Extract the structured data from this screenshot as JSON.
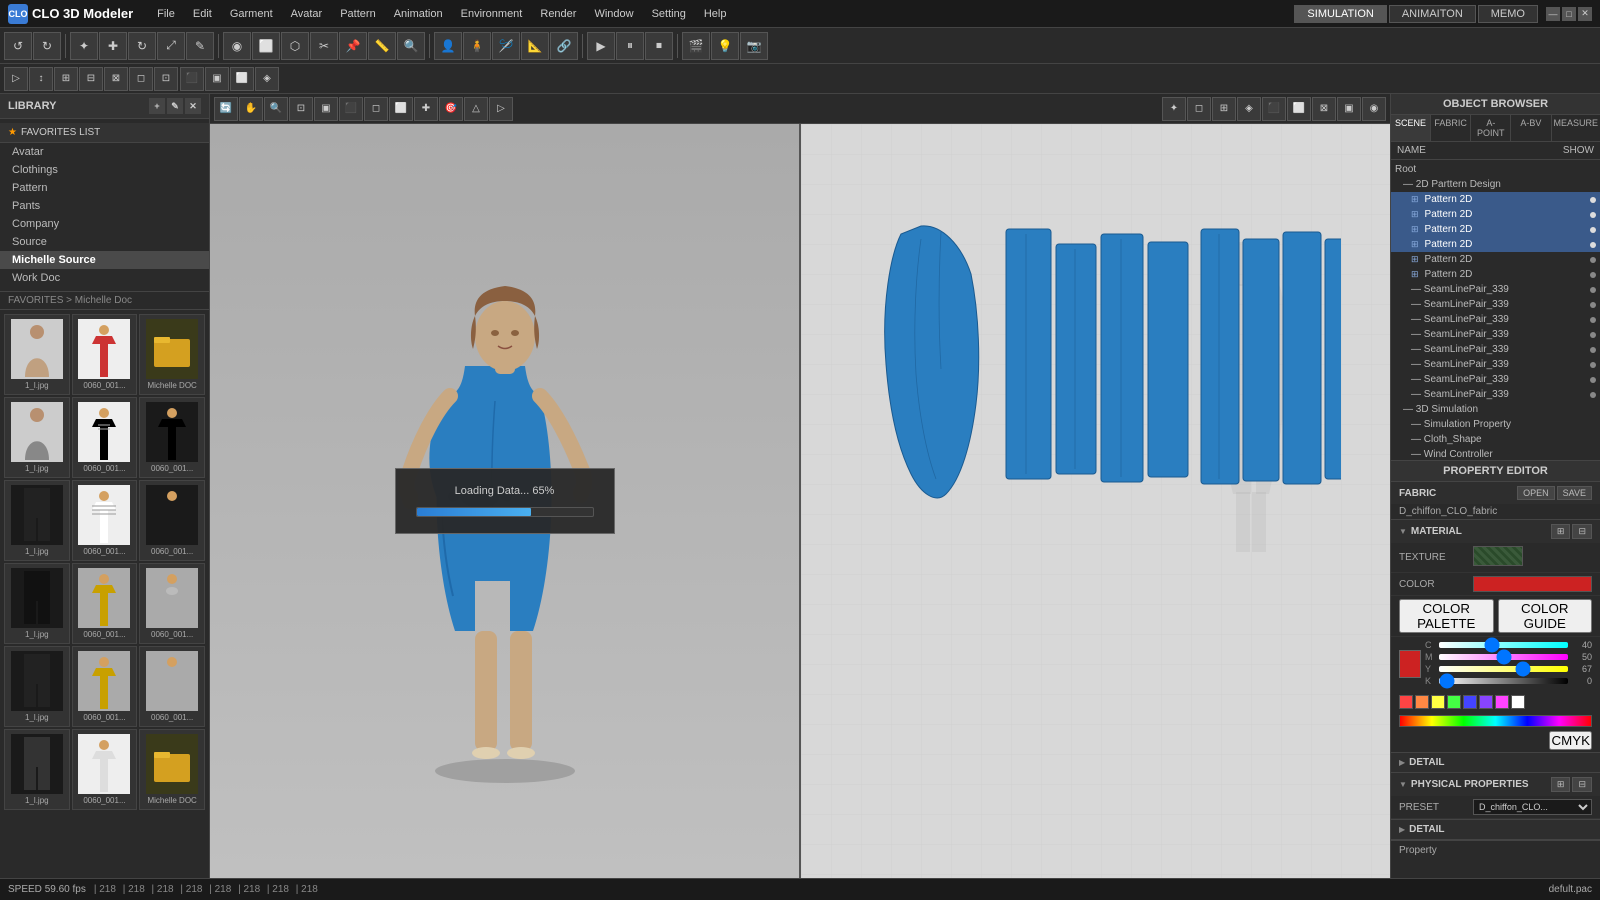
{
  "app": {
    "title": "CLO 3D Modeler",
    "logo_text": "CLO"
  },
  "topbar": {
    "menu_items": [
      "File",
      "Edit",
      "Garment",
      "Avatar",
      "Pattern",
      "Animation",
      "Environment",
      "Render",
      "Window",
      "Setting",
      "Help"
    ],
    "right_tabs": [
      "SIMULATION",
      "ANIMAITON",
      "MEMO"
    ],
    "win_btns": [
      "—",
      "□",
      "✕"
    ]
  },
  "library": {
    "header": "LIBRARY",
    "nav_items": [
      "Avatar",
      "Clothings",
      "Pattern",
      "Pants",
      "Company",
      "Source",
      "Michelle Source",
      "Work Doc"
    ],
    "active_nav": "Michelle Source",
    "favorites_label": "FAVORITES LIST",
    "breadcrumb": "FAVORITES > Michelle Doc",
    "grid_items": [
      {
        "label": "1_l.jpg",
        "type": "avatar"
      },
      {
        "label": "0060_001...",
        "type": "shirt"
      },
      {
        "label": "Michelle DOC",
        "type": "folder"
      },
      {
        "label": "1_l.jpg",
        "type": "avatar2"
      },
      {
        "label": "0060_001...",
        "type": "shirt2"
      },
      {
        "label": "0060_001...",
        "type": "jacket"
      },
      {
        "label": "1_l.jpg",
        "type": "pants"
      },
      {
        "label": "0060_001...",
        "type": "striped"
      },
      {
        "label": "0060_001...",
        "type": "jacket2"
      },
      {
        "label": "1_l.jpg",
        "type": "pants2"
      },
      {
        "label": "0060_001...",
        "type": "yellow"
      },
      {
        "label": "0060_001...",
        "type": "armor"
      },
      {
        "label": "1_l.jpg",
        "type": "pants3"
      },
      {
        "label": "0060_001...",
        "type": "yellow2"
      },
      {
        "label": "0060_001...",
        "type": "armor2"
      },
      {
        "label": "1_l.jpg",
        "type": "pants4"
      },
      {
        "label": "0060_001...",
        "type": "shirt3"
      },
      {
        "label": "Michelle DOC",
        "type": "folder2"
      }
    ]
  },
  "loading": {
    "text": "Loading Data... 65%",
    "progress": 65
  },
  "status_bar": {
    "speed_label": "SPEED",
    "speed_value": "59.60 fps",
    "coords": [
      "218",
      "218",
      "218",
      "218",
      "218",
      "218",
      "218",
      "218"
    ],
    "filename": "defult.pac"
  },
  "object_browser": {
    "header": "OBJECT BROWSER",
    "tabs": [
      "SCENE",
      "FABRIC",
      "A-POINT",
      "A-BV",
      "MEASURE"
    ],
    "active_tab": "SCENE",
    "name_label": "NAME",
    "show_label": "SHOW",
    "tree": [
      {
        "label": "Root",
        "indent": 0,
        "type": "folder"
      },
      {
        "label": "2D Parttern Design",
        "indent": 1,
        "type": "folder"
      },
      {
        "label": "Pattern 2D",
        "indent": 2,
        "selected": true
      },
      {
        "label": "Pattern 2D",
        "indent": 2,
        "selected": true
      },
      {
        "label": "Pattern 2D",
        "indent": 2,
        "selected": true
      },
      {
        "label": "Pattern 2D",
        "indent": 2,
        "selected": true
      },
      {
        "label": "Pattern 2D",
        "indent": 2
      },
      {
        "label": "Pattern 2D",
        "indent": 2
      },
      {
        "label": "SeamLinePair_339",
        "indent": 2
      },
      {
        "label": "SeamLinePair_339",
        "indent": 2
      },
      {
        "label": "SeamLinePair_339",
        "indent": 2
      },
      {
        "label": "SeamLinePair_339",
        "indent": 2
      },
      {
        "label": "SeamLinePair_339",
        "indent": 2
      },
      {
        "label": "SeamLinePair_339",
        "indent": 2
      },
      {
        "label": "SeamLinePair_339",
        "indent": 2
      },
      {
        "label": "SeamLinePair_339",
        "indent": 2
      },
      {
        "label": "3D Simulation",
        "indent": 1
      },
      {
        "label": "Simulation Property",
        "indent": 2
      },
      {
        "label": "Cloth_Shape",
        "indent": 2
      },
      {
        "label": "Wind Controller",
        "indent": 2
      }
    ]
  },
  "property_editor": {
    "header": "PROPERTY EDITOR",
    "fabric_label": "FABRIC",
    "fabric_name": "D_chiffon_CLO_fabric",
    "open_label": "OPEN",
    "save_label": "SAVE",
    "material_label": "MATERIAL",
    "texture_label": "TEXTURE",
    "color_label": "COLOR",
    "color_palette_label": "COLOR PALETTE",
    "color_guide_label": "COLOR GUIDE",
    "cmyk_label": "CMYK",
    "c_val": "40",
    "m_val": "50",
    "y_val": "67",
    "k_val": "0",
    "detail_label": "DETAIL",
    "physical_label": "PHYSICAL PROPERTIES",
    "preset_label": "PRESET",
    "preset_value": "D_chiffon_CLO...",
    "detail2_label": "DETAIL",
    "property_label": "Property"
  },
  "toolbar": {
    "tools": [
      "↺",
      "↻",
      "▶",
      "⊕",
      "✎",
      "◉",
      "⬜",
      "⬡",
      "✂",
      "↕",
      "⊙",
      "⊞",
      "⋯",
      "⊠",
      "⬛",
      "⊡",
      "⊟"
    ],
    "vp_tools": [
      "⊕",
      "↔",
      "↕",
      "⊙",
      "◻",
      "⬛",
      "⬜",
      "⊞",
      "△",
      "⊠",
      "◈",
      "◉",
      "⬡"
    ]
  }
}
